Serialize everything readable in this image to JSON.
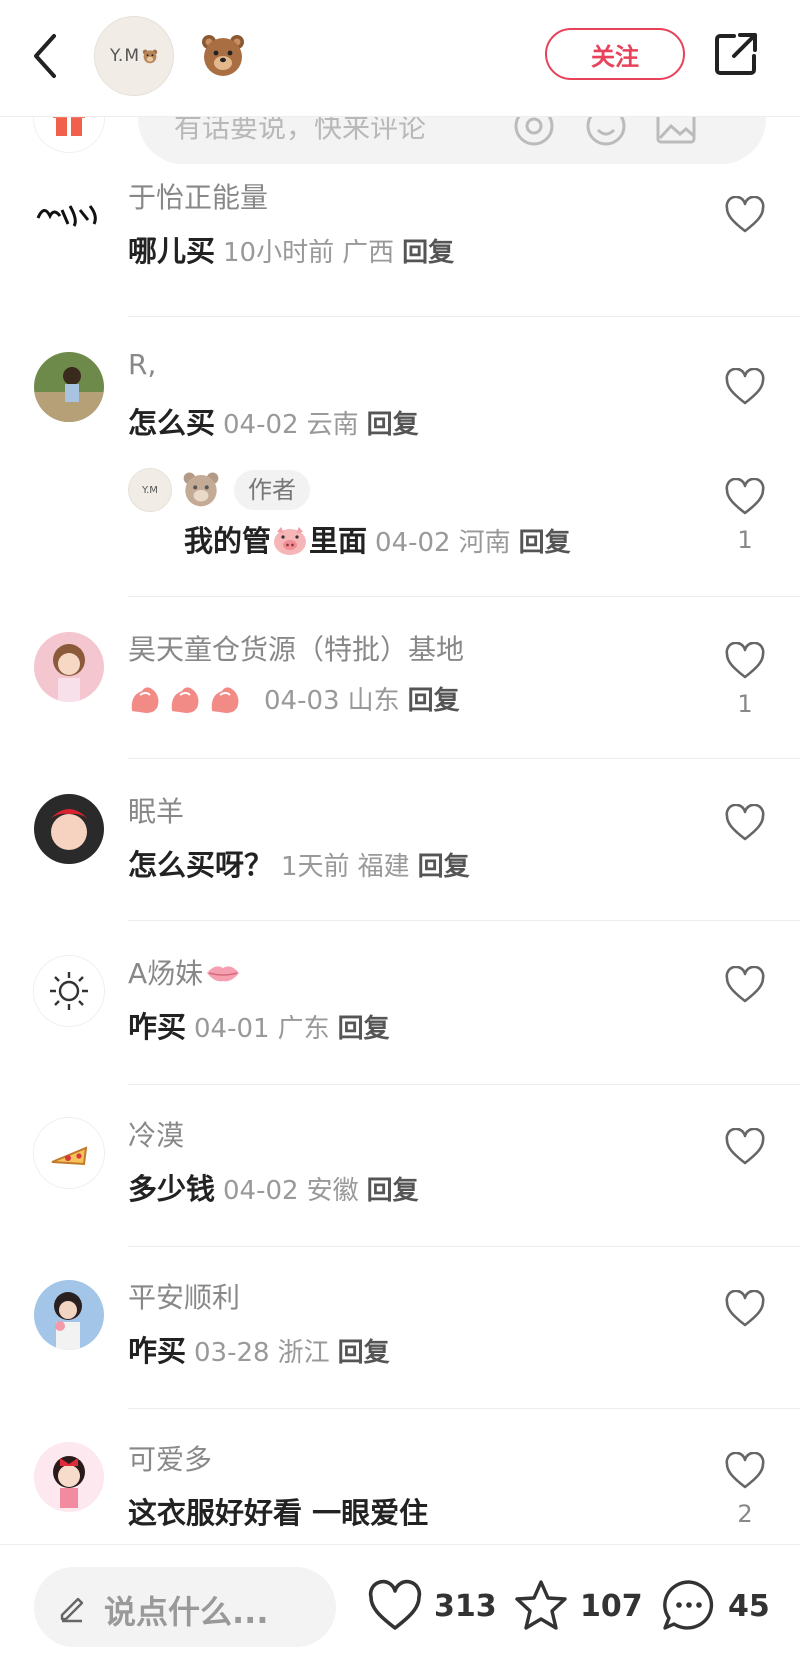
{
  "header": {
    "author_avatar_text": "Y.M",
    "follow_label": "关注"
  },
  "comment_input": {
    "placeholder": "有话要说，快来评论"
  },
  "comments": [
    {
      "user": "于怡正能量",
      "text": "哪儿买",
      "time": "10小时前",
      "location": "广西",
      "reply": "回复",
      "likes": ""
    },
    {
      "user": "R,",
      "text": "怎么买",
      "time": "04-02",
      "location": "云南",
      "reply": "回复",
      "likes": "",
      "sub_reply": {
        "avatar_text": "Y.M",
        "tag": "作者",
        "text_before": "我的管",
        "text_after": "里面",
        "time": "04-02",
        "location": "河南",
        "reply": "回复",
        "likes": "1"
      }
    },
    {
      "user": "昊天童仓货源（特批）基地",
      "text": "",
      "time": "04-03",
      "location": "山东",
      "reply": "回复",
      "likes": "1"
    },
    {
      "user": "眠羊",
      "text": "怎么买呀？",
      "time": "1天前",
      "location": "福建",
      "reply": "回复",
      "likes": ""
    },
    {
      "user": "A炀妹",
      "text": "咋买",
      "time": "04-01",
      "location": "广东",
      "reply": "回复",
      "likes": ""
    },
    {
      "user": "冷漠",
      "text": "多少钱",
      "time": "04-02",
      "location": "安徽",
      "reply": "回复",
      "likes": ""
    },
    {
      "user": "平安顺利",
      "text": "咋买",
      "time": "03-28",
      "location": "浙江",
      "reply": "回复",
      "likes": ""
    },
    {
      "user": "可爱多",
      "text": "这衣服好好看 一眼爱住",
      "time": "",
      "location": "",
      "reply": "",
      "likes": "2"
    }
  ],
  "bottom_bar": {
    "say_placeholder": "说点什么...",
    "like_count": "313",
    "star_count": "107",
    "comment_count": "45"
  },
  "colors": {
    "accent": "#e8415a"
  }
}
